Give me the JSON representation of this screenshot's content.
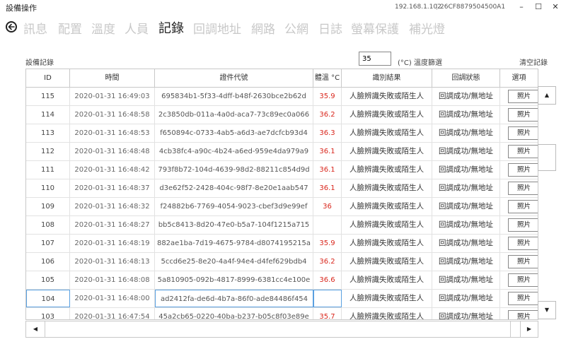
{
  "window": {
    "title": "設備操作",
    "ip": "192.168.1.102",
    "separator": "|",
    "device_id": "26CF8879504500A1",
    "minimize": "–",
    "maximize": "☐",
    "close": "✕"
  },
  "nav": {
    "back_icon": "back-arrow-icon",
    "tabs": [
      {
        "label": "訊息"
      },
      {
        "label": "配置"
      },
      {
        "label": "溫度"
      },
      {
        "label": "人員"
      },
      {
        "label": "記錄",
        "active": true
      },
      {
        "label": "回調地址"
      },
      {
        "label": "網路"
      },
      {
        "label": "公網"
      },
      {
        "label": "日誌"
      },
      {
        "label": "螢幕保護"
      },
      {
        "label": "補光燈"
      }
    ]
  },
  "toolbar": {
    "section_label": "設備記錄",
    "temp_filter_value": "35",
    "temp_filter_label": "(°C) 溫度篩選",
    "clear_label": "清空記錄"
  },
  "table": {
    "headers": {
      "id": "ID",
      "time": "時間",
      "cert": "證件代號",
      "temp": "體溫 °C",
      "result": "識別結果",
      "callback": "回調狀態",
      "options": "選項"
    },
    "photo_label": "照片",
    "rows": [
      {
        "id": "115",
        "time": "2020-01-31 16:49:03",
        "cert": "695834b1-5f33-4dff-b48f-2630bce2b62d",
        "temp": "35.9",
        "result": "人臉辨識失敗或陌生人",
        "callback": "回調成功/無地址"
      },
      {
        "id": "114",
        "time": "2020-01-31 16:48:58",
        "cert": "2c3850db-011a-4a0d-aca7-73c89ec0a066",
        "temp": "36.2",
        "result": "人臉辨識失敗或陌生人",
        "callback": "回調成功/無地址"
      },
      {
        "id": "113",
        "time": "2020-01-31 16:48:53",
        "cert": "f650894c-0733-4ab5-a6d3-ae7dcfcb93d4",
        "temp": "36.3",
        "result": "人臉辨識失敗或陌生人",
        "callback": "回調成功/無地址"
      },
      {
        "id": "112",
        "time": "2020-01-31 16:48:48",
        "cert": "4cb38fc4-a90c-4b24-a6ed-959e4da979a9",
        "temp": "36.1",
        "result": "人臉辨識失敗或陌生人",
        "callback": "回調成功/無地址"
      },
      {
        "id": "111",
        "time": "2020-01-31 16:48:42",
        "cert": "793f8b72-104d-4639-98d2-88211c854d9d",
        "temp": "36.1",
        "result": "人臉辨識失敗或陌生人",
        "callback": "回調成功/無地址"
      },
      {
        "id": "110",
        "time": "2020-01-31 16:48:37",
        "cert": "d3e62f52-2428-404c-98f7-8e20e1aab547",
        "temp": "36.1",
        "result": "人臉辨識失敗或陌生人",
        "callback": "回調成功/無地址"
      },
      {
        "id": "109",
        "time": "2020-01-31 16:48:32",
        "cert": "f24882b6-7769-4054-9023-cbef3d9e99ef",
        "temp": "36",
        "result": "人臉辨識失敗或陌生人",
        "callback": "回調成功/無地址"
      },
      {
        "id": "108",
        "time": "2020-01-31 16:48:27",
        "cert": "bb5c8413-8d20-47e0-b5a7-104f1215a715",
        "temp": "",
        "result": "人臉辨識失敗或陌生人",
        "callback": "回調成功/無地址"
      },
      {
        "id": "107",
        "time": "2020-01-31 16:48:19",
        "cert": "882ae1ba-7d19-4675-9784-d8074195215a",
        "temp": "35.9",
        "result": "人臉辨識失敗或陌生人",
        "callback": "回調成功/無地址"
      },
      {
        "id": "106",
        "time": "2020-01-31 16:48:13",
        "cert": "5ccd6e25-8e20-4a4f-94e4-d4fef629bdb4",
        "temp": "36.2",
        "result": "人臉辨識失敗或陌生人",
        "callback": "回調成功/無地址"
      },
      {
        "id": "105",
        "time": "2020-01-31 16:48:08",
        "cert": "5a810905-092b-4817-8999-6381cc4e100e",
        "temp": "36.6",
        "result": "人臉辨識失敗或陌生人",
        "callback": "回調成功/無地址"
      },
      {
        "id": "104",
        "time": "2020-01-31 16:48:00",
        "cert": "ad2412fa-de6d-4b7a-86f0-ade84486f454",
        "temp": "",
        "result": "人臉辨識失敗或陌生人",
        "callback": "回調成功/無地址",
        "selected": true
      },
      {
        "id": "103",
        "time": "2020-01-31 16:47:54",
        "cert": "45a2cb65-0220-40ba-b237-b05c8f03e89e",
        "temp": "35.7",
        "result": "人臉辨識失敗或陌生人",
        "callback": "回調成功/無地址"
      }
    ]
  },
  "scrollbars": {
    "up": "▲",
    "down": "▼",
    "left": "◀",
    "right": "▶"
  },
  "colors": {
    "temperature": "#d9261c",
    "selection_border": "#5aa0e0",
    "inactive_tab": "#c8c8c8"
  }
}
